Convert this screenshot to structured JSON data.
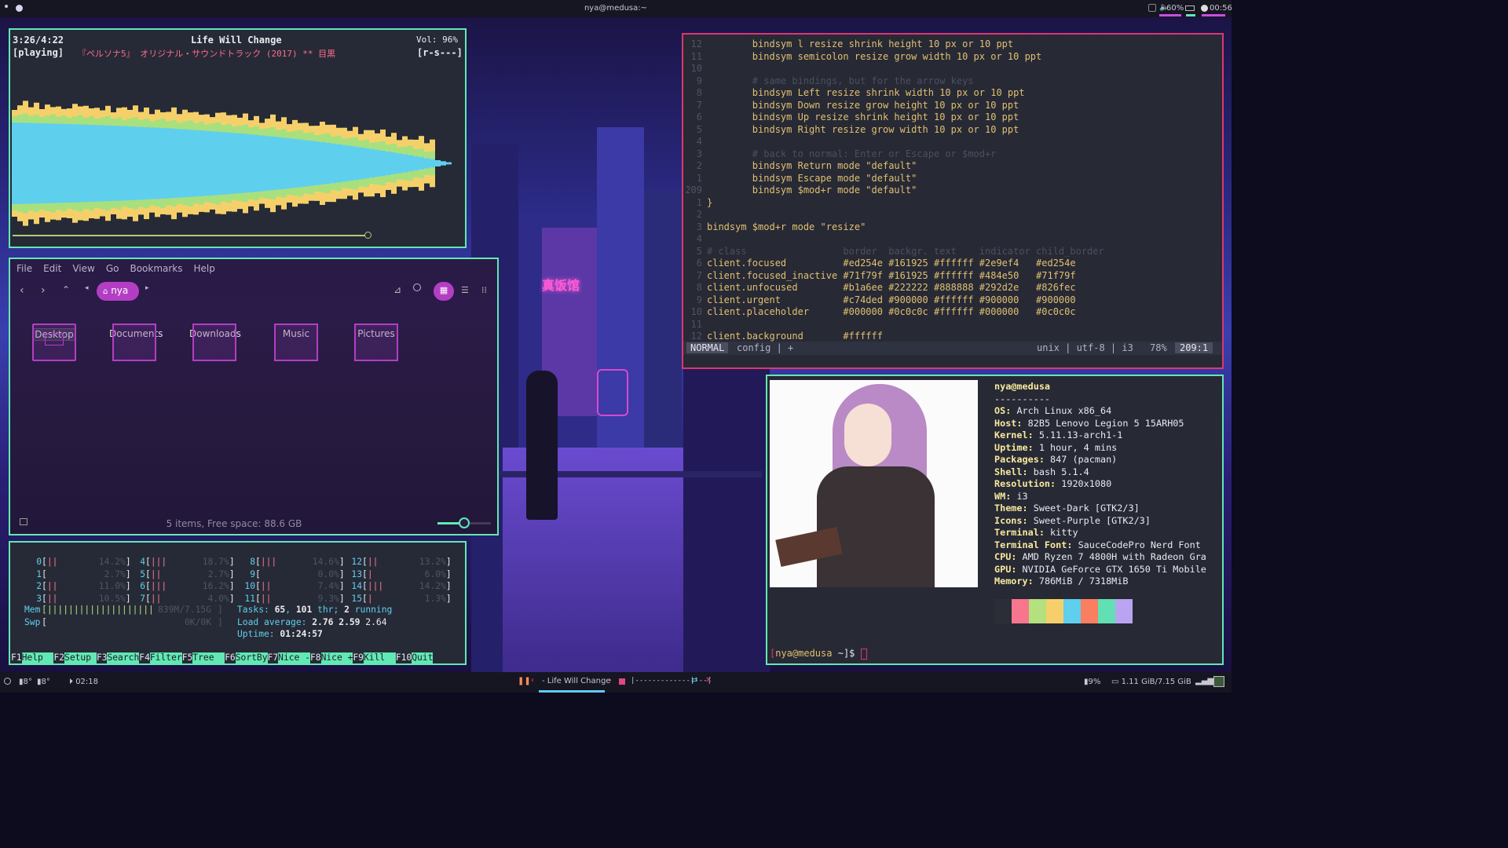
{
  "topbar": {
    "title": "nya@medusa:~",
    "volume": "60%",
    "clock": "00:56"
  },
  "bottombar": {
    "left_a": "8°",
    "left_b": "8°",
    "elapsed": "02:18",
    "track": "- Life Will Change",
    "progress": "|-------------|---|",
    "battery": "9%",
    "memory": "1.11 GiB/7.15 GiB"
  },
  "cava": {
    "time": "3:26/4:22",
    "status": "[playing]",
    "title": "Life Will Change",
    "album": "『ペルソナ5』 オリジナル・サウンドトラック (2017) ** 目黒",
    "volume": "Vol: 96%",
    "flags": "[r-s---]",
    "progress": 0.78
  },
  "files": {
    "menu": [
      "File",
      "Edit",
      "View",
      "Go",
      "Bookmarks",
      "Help"
    ],
    "location": "nya",
    "folders": [
      "Desktop",
      "Documents",
      "Downloads",
      "Music",
      "Pictures"
    ],
    "status": "5 items, Free space: 88.6 GB",
    "zoom": 0.5
  },
  "htop": {
    "cpus": [
      {
        "n": "0",
        "bar": "||",
        "pct": "14.2%"
      },
      {
        "n": "1",
        "bar": "",
        "pct": "2.7%"
      },
      {
        "n": "2",
        "bar": "||",
        "pct": "11.0%"
      },
      {
        "n": "3",
        "bar": "||",
        "pct": "10.5%"
      },
      {
        "n": "4",
        "bar": "|||",
        "pct": "18.7%"
      },
      {
        "n": "5",
        "bar": "||",
        "pct": "2.7%"
      },
      {
        "n": "6",
        "bar": "|||",
        "pct": "16.2%"
      },
      {
        "n": "7",
        "bar": "||",
        "pct": "4.0%"
      },
      {
        "n": "8",
        "bar": "|||",
        "pct": "14.6%"
      },
      {
        "n": "9",
        "bar": "",
        "pct": "0.0%"
      },
      {
        "n": "10",
        "bar": "||",
        "pct": "7.4%"
      },
      {
        "n": "11",
        "bar": "||",
        "pct": "9.3%"
      },
      {
        "n": "12",
        "bar": "||",
        "pct": "13.2%"
      },
      {
        "n": "13",
        "bar": "|",
        "pct": "6.0%"
      },
      {
        "n": "14",
        "bar": "|||",
        "pct": "14.2%"
      },
      {
        "n": "15",
        "bar": "|",
        "pct": "1.3%"
      }
    ],
    "mem_label": "Mem",
    "mem_bar": "||||||||||||||||||||",
    "mem_val": "839M/7.15G",
    "swp_label": "Swp",
    "swp_val": "0K/0K",
    "tasks_label": "Tasks:",
    "tasks": "65",
    "thr": "101",
    "thr_label": "thr;",
    "running": "2",
    "running_label": "running",
    "load_label": "Load average:",
    "load1": "2.76",
    "load5": "2.59",
    "load15": "2.64",
    "uptime_label": "Uptime:",
    "uptime": "01:24:57",
    "fkeys": [
      {
        "k": "F1",
        "l": "Help  "
      },
      {
        "k": "F2",
        "l": "Setup "
      },
      {
        "k": "F3",
        "l": "Search"
      },
      {
        "k": "F4",
        "l": "Filter"
      },
      {
        "k": "F5",
        "l": "Tree  "
      },
      {
        "k": "F6",
        "l": "SortBy"
      },
      {
        "k": "F7",
        "l": "Nice -"
      },
      {
        "k": "F8",
        "l": "Nice +"
      },
      {
        "k": "F9",
        "l": "Kill  "
      },
      {
        "k": "F10",
        "l": "Quit"
      }
    ]
  },
  "vim": {
    "lines": [
      {
        "n": "12",
        "t": "        bindsym l resize shrink height 10 px or 10 ppt",
        "c": "kw"
      },
      {
        "n": "11",
        "t": "        bindsym semicolon resize grow width 10 px or 10 ppt",
        "c": "kw"
      },
      {
        "n": "10",
        "t": "",
        "c": "kw"
      },
      {
        "n": "9",
        "t": "        # same bindings, but for the arrow keys",
        "c": "cm"
      },
      {
        "n": "8",
        "t": "        bindsym Left resize shrink width 10 px or 10 ppt",
        "c": "kw"
      },
      {
        "n": "7",
        "t": "        bindsym Down resize grow height 10 px or 10 ppt",
        "c": "kw"
      },
      {
        "n": "6",
        "t": "        bindsym Up resize shrink height 10 px or 10 ppt",
        "c": "kw"
      },
      {
        "n": "5",
        "t": "        bindsym Right resize grow width 10 px or 10 ppt",
        "c": "kw"
      },
      {
        "n": "4",
        "t": "",
        "c": "kw"
      },
      {
        "n": "3",
        "t": "        # back to normal: Enter or Escape or $mod+r",
        "c": "cm"
      },
      {
        "n": "2",
        "t": "        bindsym Return mode \"default\"",
        "c": "kw"
      },
      {
        "n": "1",
        "t": "        bindsym Escape mode \"default\"",
        "c": "kw"
      },
      {
        "n": "209",
        "t": "        bindsym $mod+r mode \"default\"",
        "c": "kw"
      },
      {
        "n": "1",
        "t": "}",
        "c": "kw"
      },
      {
        "n": "2",
        "t": "",
        "c": "kw"
      },
      {
        "n": "3",
        "t": "bindsym $mod+r mode \"resize\"",
        "c": "kw"
      },
      {
        "n": "4",
        "t": "",
        "c": "kw"
      },
      {
        "n": "5",
        "t": "# class                 border  backgr. text    indicator child_border",
        "c": "cm"
      },
      {
        "n": "6",
        "t": "client.focused          #ed254e #161925 #ffffff #2e9ef4   #ed254e",
        "c": "kw"
      },
      {
        "n": "7",
        "t": "client.focused_inactive #71f79f #161925 #ffffff #484e50   #71f79f",
        "c": "kw"
      },
      {
        "n": "8",
        "t": "client.unfocused        #b1a6ee #222222 #888888 #292d2e   #826fec",
        "c": "kw"
      },
      {
        "n": "9",
        "t": "client.urgent           #c74ded #900000 #ffffff #900000   #900000",
        "c": "kw"
      },
      {
        "n": "10",
        "t": "client.placeholder      #000000 #0c0c0c #ffffff #000000   #0c0c0c",
        "c": "kw"
      },
      {
        "n": "11",
        "t": "",
        "c": "kw"
      },
      {
        "n": "12",
        "t": "client.background       #ffffff",
        "c": "kw"
      }
    ],
    "mode": "NORMAL",
    "file": "config | +",
    "info": "unix | utf-8 | i3",
    "percent": "78%",
    "pos": "209:1"
  },
  "neofetch": {
    "userhost": "nya@medusa",
    "sep": "----------",
    "fields": [
      {
        "k": "OS",
        "v": "Arch Linux x86_64"
      },
      {
        "k": "Host",
        "v": "82B5 Lenovo Legion 5 15ARH05"
      },
      {
        "k": "Kernel",
        "v": "5.11.13-arch1-1"
      },
      {
        "k": "Uptime",
        "v": "1 hour, 4 mins"
      },
      {
        "k": "Packages",
        "v": "847 (pacman)"
      },
      {
        "k": "Shell",
        "v": "bash 5.1.4"
      },
      {
        "k": "Resolution",
        "v": "1920x1080"
      },
      {
        "k": "WM",
        "v": "i3"
      },
      {
        "k": "Theme",
        "v": "Sweet-Dark [GTK2/3]"
      },
      {
        "k": "Icons",
        "v": "Sweet-Purple [GTK2/3]"
      },
      {
        "k": "Terminal",
        "v": "kitty"
      },
      {
        "k": "Terminal Font",
        "v": "SauceCodePro Nerd Font"
      },
      {
        "k": "CPU",
        "v": "AMD Ryzen 7 4800H with Radeon Gra"
      },
      {
        "k": "GPU",
        "v": "NVIDIA GeForce GTX 1650 Ti Mobile"
      },
      {
        "k": "Memory",
        "v": "786MiB / 7318MiB"
      }
    ],
    "palette": [
      "#2b2d37",
      "#f7768e",
      "#b4e07e",
      "#f5d06a",
      "#5fcfee",
      "#fa7e60",
      "#62e0b4",
      "#b9a4f2"
    ],
    "prompt_user": "nya@medusa",
    "prompt_dir": "~",
    "prompt_sym": "]$"
  }
}
